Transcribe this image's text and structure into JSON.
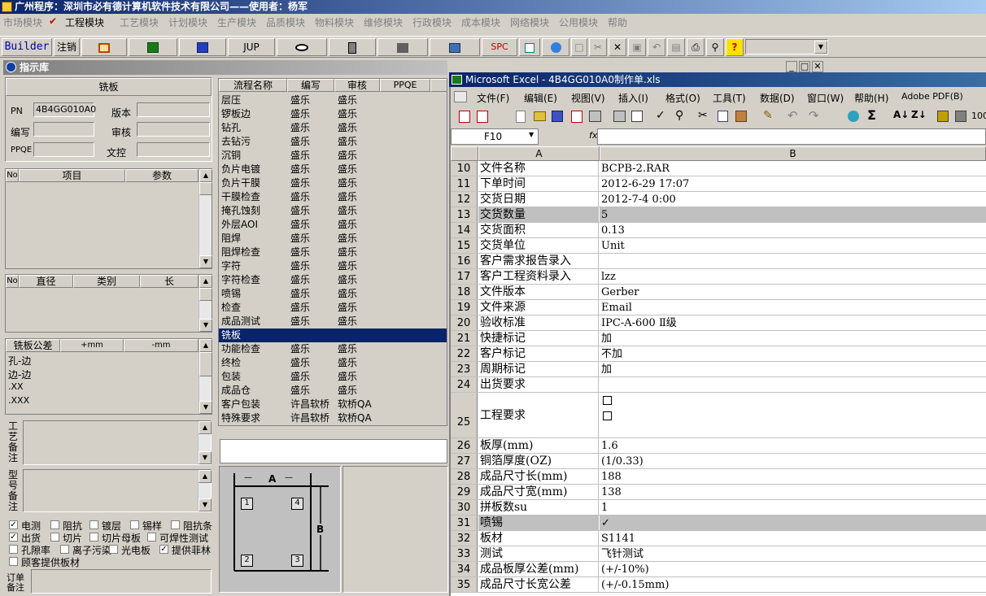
{
  "app": {
    "title": "广州程序：深圳市必有德计算机软件技术有限公司——使用者：杨军",
    "menu": [
      "市场模块",
      "工程模块",
      "工艺模块",
      "计划模块",
      "生产模块",
      "品质模块",
      "物料模块",
      "维修模块",
      "行政模块",
      "成本模块",
      "网络模块",
      "公用模块",
      "帮助"
    ],
    "active_menu_index": 1,
    "toolbar": {
      "builder": "Builder",
      "logout": "注销",
      "jup": "JUP",
      "spc": "SPC"
    }
  },
  "left": {
    "window_title": "指示库",
    "header": "铣板",
    "pn_label": "PN",
    "pn_value": "4B4GG010A0",
    "version_label": "版本",
    "writer_label": "编写",
    "reviewer_label": "审核",
    "ppqe_label": "PPQE",
    "doc_label": "文控",
    "grid1_headers": [
      "No",
      "项目",
      "参数"
    ],
    "grid2_headers": [
      "No",
      "直径",
      "类别",
      "长"
    ],
    "tol_headers": [
      "铣板公差",
      "+mm",
      "-mm"
    ],
    "tol_rows": [
      "孔-边",
      "边-边",
      ".XX",
      ".XXX"
    ],
    "remark1_label": "工艺备注",
    "remark2_label": "型号备注",
    "order_label": "订单备注",
    "checkboxes": [
      {
        "label": "电测",
        "checked": true
      },
      {
        "label": "阻抗",
        "checked": false
      },
      {
        "label": "镀层",
        "checked": false
      },
      {
        "label": "锡样",
        "checked": false
      },
      {
        "label": "阻抗条",
        "checked": false
      },
      {
        "label": "出货",
        "checked": true
      },
      {
        "label": "切片",
        "checked": false
      },
      {
        "label": "切片母板",
        "checked": false
      },
      {
        "label": "可焊性测试",
        "checked": false
      },
      {
        "label": "孔隙率",
        "checked": false
      },
      {
        "label": "离子污染",
        "checked": false
      },
      {
        "label": "光电板",
        "checked": false
      },
      {
        "label": "提供菲林",
        "checked": true
      },
      {
        "label": "顾客提供板材",
        "checked": false
      }
    ]
  },
  "process": {
    "headers": [
      "流程名称",
      "编写",
      "审核",
      "PPQE"
    ],
    "rows": [
      [
        "层压",
        "盛乐",
        "盛乐"
      ],
      [
        "锣板边",
        "盛乐",
        "盛乐"
      ],
      [
        "钻孔",
        "盛乐",
        "盛乐"
      ],
      [
        "去钻污",
        "盛乐",
        "盛乐"
      ],
      [
        "沉铜",
        "盛乐",
        "盛乐"
      ],
      [
        "负片电镀",
        "盛乐",
        "盛乐"
      ],
      [
        "负片干膜",
        "盛乐",
        "盛乐"
      ],
      [
        "干膜检查",
        "盛乐",
        "盛乐"
      ],
      [
        "掩孔蚀刻",
        "盛乐",
        "盛乐"
      ],
      [
        "外层AOI",
        "盛乐",
        "盛乐"
      ],
      [
        "阻焊",
        "盛乐",
        "盛乐"
      ],
      [
        "阻焊检查",
        "盛乐",
        "盛乐"
      ],
      [
        "字符",
        "盛乐",
        "盛乐"
      ],
      [
        "字符检查",
        "盛乐",
        "盛乐"
      ],
      [
        "喷锡",
        "盛乐",
        "盛乐"
      ],
      [
        "检查",
        "盛乐",
        "盛乐"
      ],
      [
        "成品测试",
        "盛乐",
        "盛乐"
      ],
      [
        "铣板",
        "",
        ""
      ],
      [
        "功能检查",
        "盛乐",
        "盛乐"
      ],
      [
        "终检",
        "盛乐",
        "盛乐"
      ],
      [
        "包装",
        "盛乐",
        "盛乐"
      ],
      [
        "成品仓",
        "盛乐",
        "盛乐"
      ],
      [
        "客户包装",
        "许昌软桥",
        "软桥QA"
      ],
      [
        "特殊要求",
        "许昌软桥",
        "软桥QA"
      ]
    ],
    "selected_index": 17
  },
  "diagram": {
    "label_a": "A",
    "label_b": "B",
    "corners": [
      "1",
      "4",
      "2",
      "3"
    ]
  },
  "excel": {
    "title": "Microsoft Excel - 4B4GG010A0制作单.xls",
    "menu": [
      "文件(F)",
      "编辑(E)",
      "视图(V)",
      "插入(I)",
      "格式(O)",
      "工具(T)",
      "数据(D)",
      "窗口(W)",
      "帮助(H)",
      "Adobe PDF(B)"
    ],
    "zoom": "100",
    "name_box": "F10",
    "fx": "fx",
    "col_a": "A",
    "col_b": "B",
    "rows": [
      {
        "n": "10",
        "a": "文件名称",
        "b": "BCPB-2.RAR"
      },
      {
        "n": "11",
        "a": "下单时间",
        "b": "2012-6-29 17:07"
      },
      {
        "n": "12",
        "a": "交货日期",
        "b": "2012-7-4 0:00"
      },
      {
        "n": "13",
        "a": "交货数量",
        "b": "5"
      },
      {
        "n": "14",
        "a": "交货面积",
        "b": "0.13"
      },
      {
        "n": "15",
        "a": "交货单位",
        "b": "Unit"
      },
      {
        "n": "16",
        "a": "客户需求报告录入",
        "b": ""
      },
      {
        "n": "17",
        "a": "客户工程资料录入",
        "b": "lzz"
      },
      {
        "n": "18",
        "a": "文件版本",
        "b": "Gerber"
      },
      {
        "n": "19",
        "a": "文件来源",
        "b": "Email"
      },
      {
        "n": "20",
        "a": "验收标准",
        "b": "IPC-A-600 Ⅱ级"
      },
      {
        "n": "21",
        "a": "快捷标记",
        "b": "加"
      },
      {
        "n": "22",
        "a": "客户标记",
        "b": "不加"
      },
      {
        "n": "23",
        "a": "周期标记",
        "b": "加"
      },
      {
        "n": "24",
        "a": "出货要求",
        "b": ""
      },
      {
        "n": "25",
        "a": "工程要求",
        "b": ""
      },
      {
        "n": "26",
        "a": "板厚(mm)",
        "b": "1.6"
      },
      {
        "n": "27",
        "a": "铜箔厚度(OZ)",
        "b": " (1/0.33)"
      },
      {
        "n": "28",
        "a": "成品尺寸长(mm)",
        "b": "188"
      },
      {
        "n": "29",
        "a": "成品尺寸宽(mm)",
        "b": "138"
      },
      {
        "n": "30",
        "a": "拼板数su",
        "b": "1"
      },
      {
        "n": "31",
        "a": "喷锡",
        "b": "✓"
      },
      {
        "n": "32",
        "a": "板材",
        "b": "S1141"
      },
      {
        "n": "33",
        "a": "测试",
        "b": "飞针测试"
      },
      {
        "n": "34",
        "a": "成品板厚公差(mm)",
        "b": " (+/-10%)"
      },
      {
        "n": "35",
        "a": "成品尺寸长宽公差",
        "b": " (+/-0.15mm)"
      }
    ]
  }
}
